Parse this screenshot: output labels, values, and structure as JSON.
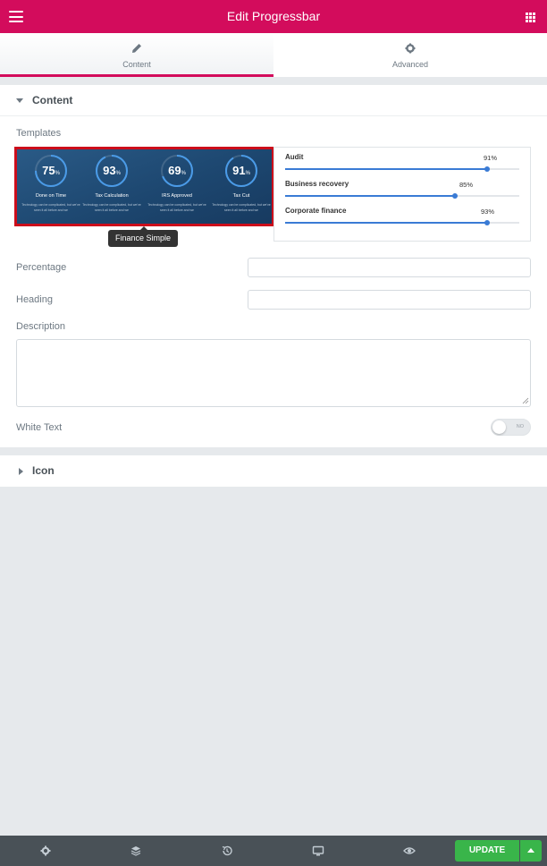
{
  "header": {
    "title": "Edit Progressbar",
    "menu_icon": "hamburger-icon",
    "apps_icon": "grid-icon"
  },
  "tabs": [
    {
      "label": "Content",
      "icon": "pencil-icon",
      "active": true
    },
    {
      "label": "Advanced",
      "icon": "gear-icon",
      "active": false
    }
  ],
  "content_section": {
    "title": "Content",
    "templates_label": "Templates",
    "tooltip": "Finance Simple",
    "template_finance": {
      "items": [
        {
          "value": 75,
          "unit": "%",
          "name": "Done on Time",
          "desc": "Technology can be complicated, but we've seen it all before and we"
        },
        {
          "value": 93,
          "unit": "%",
          "name": "Tax Calculation",
          "desc": "Technology can be complicated, but we've seen it all before and we"
        },
        {
          "value": 69,
          "unit": "%",
          "name": "IRS Approved",
          "desc": "Technology can be complicated, but we've seen it all before and we"
        },
        {
          "value": 91,
          "unit": "%",
          "name": "Tax Cut",
          "desc": "Technology can be complicated, but we've seen it all before and we"
        }
      ]
    },
    "template_bars": {
      "items": [
        {
          "name": "Audit",
          "percent": 91,
          "label": "91%"
        },
        {
          "name": "Business recovery",
          "percent": 73,
          "label": "85%"
        },
        {
          "name": "Corporate finance",
          "percent": 86,
          "label": "93%"
        }
      ]
    },
    "percentage_label": "Percentage",
    "percentage_value": "",
    "heading_label": "Heading",
    "heading_value": "",
    "description_label": "Description",
    "description_value": "",
    "white_text_label": "White Text",
    "white_text_toggle": "NO"
  },
  "icon_section": {
    "title": "Icon"
  },
  "footer": {
    "icons": [
      "settings-icon",
      "layers-icon",
      "history-icon",
      "desktop-icon",
      "eye-icon"
    ],
    "update_label": "UPDATE"
  },
  "colors": {
    "brand": "#d30c5c",
    "update": "#39b54a",
    "footer": "#495157",
    "selected_border": "#cc0d1b",
    "bar": "#3a7bd5"
  }
}
